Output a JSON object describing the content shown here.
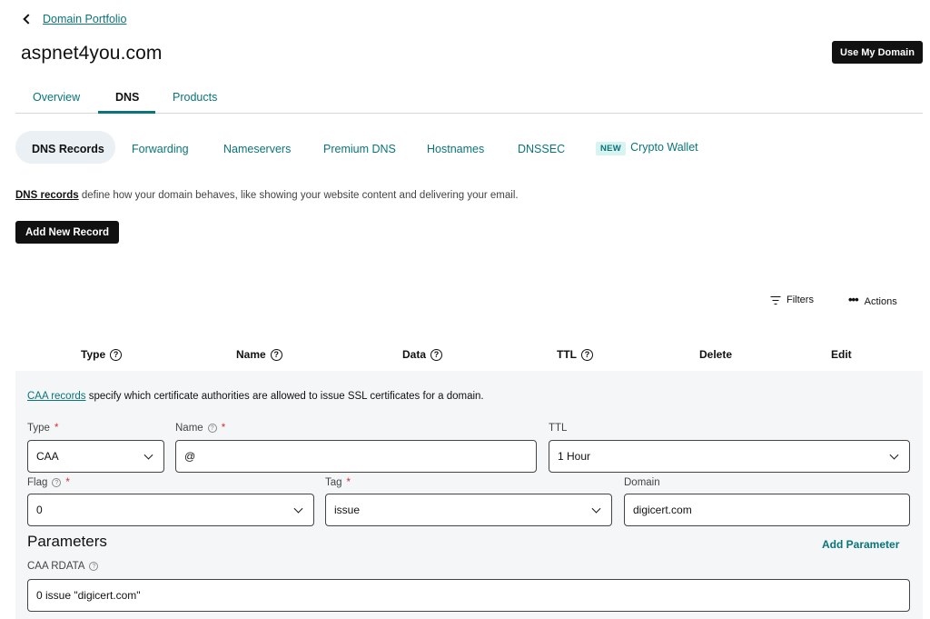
{
  "breadcrumb": {
    "label": "Domain Portfolio"
  },
  "domain": {
    "name": "aspnet4you.com"
  },
  "header": {
    "use_domain_label": "Use My Domain"
  },
  "tabs": [
    {
      "label": "Overview"
    },
    {
      "label": "DNS"
    },
    {
      "label": "Products"
    }
  ],
  "subtabs": [
    {
      "label": "DNS Records"
    },
    {
      "label": "Forwarding"
    },
    {
      "label": "Nameservers"
    },
    {
      "label": "Premium DNS"
    },
    {
      "label": "Hostnames"
    },
    {
      "label": "DNSSEC"
    },
    {
      "label": "Crypto Wallet",
      "badge": "NEW"
    }
  ],
  "info": {
    "link": "DNS records",
    "text": " define how your domain behaves, like showing your website content and delivering your email."
  },
  "add_record_label": "Add New Record",
  "toolbar": {
    "filters_label": "Filters",
    "actions_label": "Actions"
  },
  "table_headers": [
    {
      "label": "Type"
    },
    {
      "label": "Name"
    },
    {
      "label": "Data"
    },
    {
      "label": "TTL"
    },
    {
      "label": "Delete"
    },
    {
      "label": "Edit"
    }
  ],
  "help_glyph": "?",
  "required_mark": "*",
  "record": {
    "info_link": "CAA records",
    "info_text": " specify which certificate authorities are allowed to issue SSL certificates for a domain.",
    "type": {
      "label": "Type",
      "value": "CAA"
    },
    "name": {
      "label": "Name",
      "value": "@"
    },
    "ttl": {
      "label": "TTL",
      "value": "1 Hour"
    },
    "flag": {
      "label": "Flag",
      "value": "0"
    },
    "tag": {
      "label": "Tag",
      "value": "issue"
    },
    "domain": {
      "label": "Domain",
      "value": "digicert.com"
    },
    "parameters_title": "Parameters",
    "add_parameter_label": "Add Parameter",
    "rdata": {
      "label": "CAA RDATA",
      "value": "0 issue \"digicert.com\""
    }
  },
  "colors": {
    "accent": "#09757a",
    "primary_button": "#111111",
    "required": "#d62e2e",
    "panel_bg": "#f4f6f8"
  }
}
